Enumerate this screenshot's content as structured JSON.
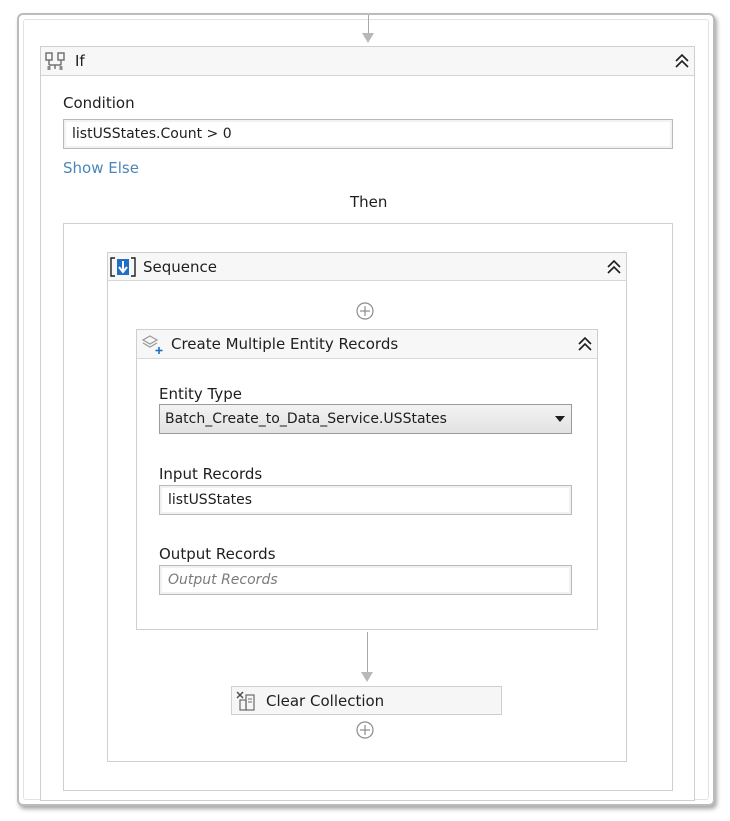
{
  "if_activity": {
    "title": "If",
    "icon": "if-activity-icon",
    "condition_label": "Condition",
    "condition_value": "listUSStates.Count > 0",
    "show_else_label": "Show Else",
    "then_label": "Then"
  },
  "sequence": {
    "title": "Sequence",
    "icon": "sequence-icon"
  },
  "create_multiple": {
    "title": "Create Multiple Entity Records",
    "icon": "create-entity-records-icon",
    "entity_type_label": "Entity Type",
    "entity_type_value": "Batch_Create_to_Data_Service.USStates",
    "input_records_label": "Input Records",
    "input_records_value": "listUSStates",
    "output_records_label": "Output Records",
    "output_records_placeholder": "Output Records"
  },
  "clear_collection": {
    "title": "Clear Collection",
    "icon": "clear-collection-icon"
  },
  "colors": {
    "link": "#4a86b8",
    "sequence_icon_blue": "#1f6fc5",
    "border": "#cfcfcf",
    "header_bg": "#f7f7f7"
  }
}
